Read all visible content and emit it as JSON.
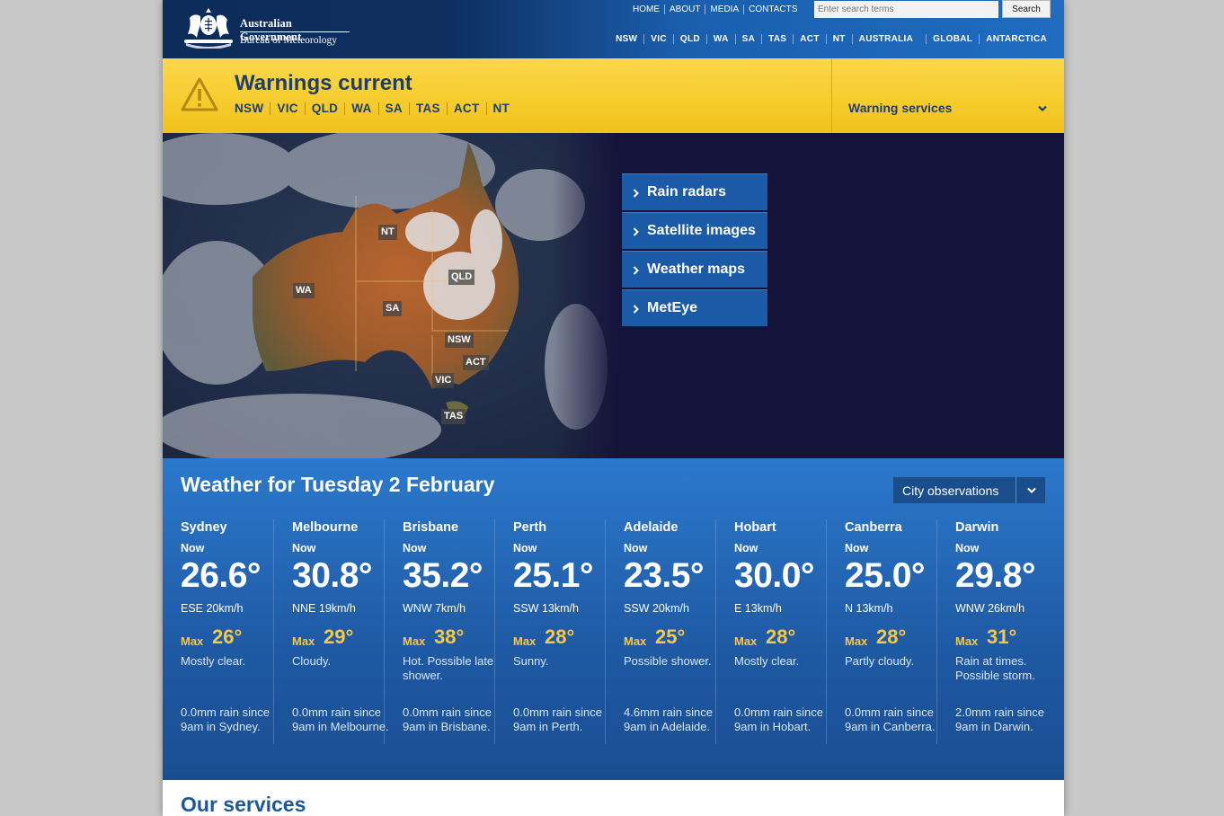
{
  "header": {
    "gov_name": "Australian Government",
    "agency_name": "Bureau of Meteorology",
    "top_links": [
      "HOME",
      "ABOUT",
      "MEDIA",
      "CONTACTS"
    ],
    "search": {
      "placeholder": "Enter search terms",
      "button_label": "Search"
    },
    "state_links": [
      "NSW",
      "VIC",
      "QLD",
      "WA",
      "SA",
      "TAS",
      "ACT",
      "NT",
      "AUSTRALIA"
    ],
    "world_links": [
      "GLOBAL",
      "ANTARCTICA"
    ]
  },
  "warnings": {
    "title": "Warnings current",
    "states": [
      "NSW",
      "VIC",
      "QLD",
      "WA",
      "SA",
      "TAS",
      "ACT",
      "NT"
    ],
    "services_label": "Warning services",
    "icon": "warning-triangle-icon"
  },
  "map": {
    "labels": [
      "NT",
      "WA",
      "QLD",
      "SA",
      "NSW",
      "ACT",
      "VIC",
      "TAS"
    ]
  },
  "quicklinks": [
    "Rain radars",
    "Satellite images",
    "Weather maps",
    "MetEye"
  ],
  "weather": {
    "title": "Weather for Tuesday 2 February",
    "view_select": "City observations",
    "cities": [
      {
        "name": "Sydney",
        "now": "Now",
        "temp": "26.6°",
        "wind": "ESE 20km/h",
        "max_label": "Max",
        "max": "26°",
        "forecast": "Mostly clear.",
        "rain": "0.0mm rain since 9am in Sydney."
      },
      {
        "name": "Melbourne",
        "now": "Now",
        "temp": "30.8°",
        "wind": "NNE 19km/h",
        "max_label": "Max",
        "max": "29°",
        "forecast": "Cloudy.",
        "rain": "0.0mm rain since 9am in Melbourne."
      },
      {
        "name": "Brisbane",
        "now": "Now",
        "temp": "35.2°",
        "wind": "WNW 7km/h",
        "max_label": "Max",
        "max": "38°",
        "forecast": "Hot. Possible late shower.",
        "rain": "0.0mm rain since 9am in Brisbane."
      },
      {
        "name": "Perth",
        "now": "Now",
        "temp": "25.1°",
        "wind": "SSW 13km/h",
        "max_label": "Max",
        "max": "28°",
        "forecast": "Sunny.",
        "rain": "0.0mm rain since 9am in Perth."
      },
      {
        "name": "Adelaide",
        "now": "Now",
        "temp": "23.5°",
        "wind": "SSW 20km/h",
        "max_label": "Max",
        "max": "25°",
        "forecast": "Possible shower.",
        "rain": "4.6mm rain since 9am in Adelaide."
      },
      {
        "name": "Hobart",
        "now": "Now",
        "temp": "30.0°",
        "wind": "E 13km/h",
        "max_label": "Max",
        "max": "28°",
        "forecast": "Mostly clear.",
        "rain": "0.0mm rain since 9am in Hobart."
      },
      {
        "name": "Canberra",
        "now": "Now",
        "temp": "25.0°",
        "wind": "N 13km/h",
        "max_label": "Max",
        "max": "28°",
        "forecast": "Partly cloudy.",
        "rain": "0.0mm rain since 9am in Canberra."
      },
      {
        "name": "Darwin",
        "now": "Now",
        "temp": "29.8°",
        "wind": "WNW 26km/h",
        "max_label": "Max",
        "max": "31°",
        "forecast": "Rain at times. Possible storm.",
        "rain": "2.0mm rain since 9am in Darwin."
      }
    ]
  },
  "services": {
    "title": "Our services"
  },
  "colors": {
    "accent_yellow": "#f5c84a",
    "warning_bar": "#f9d23a",
    "header_navy": "#0c2c5a",
    "panel_blue": "#2569b8"
  }
}
